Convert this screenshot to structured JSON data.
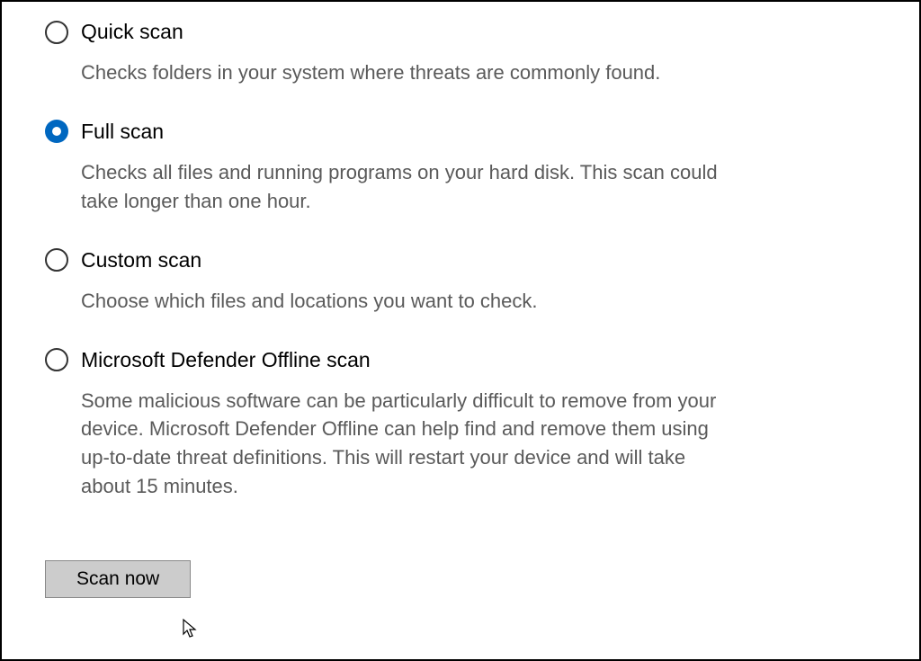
{
  "options": [
    {
      "id": "quick",
      "title": "Quick scan",
      "description": "Checks folders in your system where threats are commonly found.",
      "selected": false
    },
    {
      "id": "full",
      "title": "Full scan",
      "description": "Checks all files and running programs on your hard disk. This scan could take longer than one hour.",
      "selected": true
    },
    {
      "id": "custom",
      "title": "Custom scan",
      "description": "Choose which files and locations you want to check.",
      "selected": false
    },
    {
      "id": "offline",
      "title": "Microsoft Defender Offline scan",
      "description": "Some malicious software can be particularly difficult to remove from your device. Microsoft Defender Offline can help find and remove them using up-to-date threat definitions. This will restart your device and will take about 15 minutes.",
      "selected": false
    }
  ],
  "button": {
    "scan_now": "Scan now"
  },
  "colors": {
    "accent": "#0067C0"
  }
}
